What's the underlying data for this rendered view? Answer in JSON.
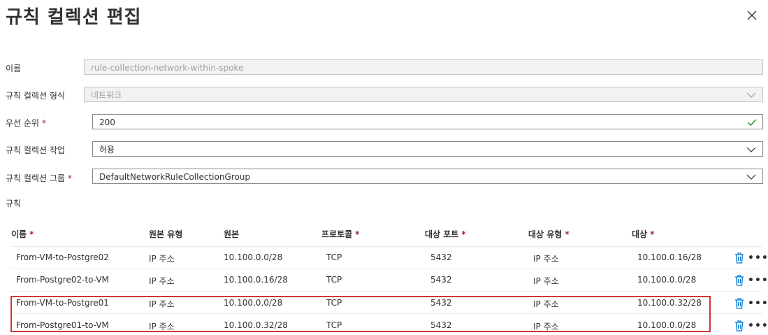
{
  "header": {
    "title": "규칙 컬렉션 편집"
  },
  "form": {
    "name": {
      "label": "이름",
      "value": "rule-collection-network-within-spoke"
    },
    "type": {
      "label": "규칙 컬렉션 형식",
      "value": "네트워크"
    },
    "priority": {
      "label": "우선 순위",
      "required": "*",
      "value": "200"
    },
    "action": {
      "label": "규칙 컬렉션 작업",
      "value": "허용"
    },
    "group": {
      "label": "규칙 컬렉션 그룹",
      "required": "*",
      "value": "DefaultNetworkRuleCollectionGroup"
    },
    "rules_label": "규칙"
  },
  "table": {
    "columns": [
      {
        "label": "이름",
        "required": "*"
      },
      {
        "label": "원본 유형",
        "required": ""
      },
      {
        "label": "원본",
        "required": ""
      },
      {
        "label": "프로토콜",
        "required": "*"
      },
      {
        "label": "대상 포트",
        "required": "*"
      },
      {
        "label": "대상 유형",
        "required": "*"
      },
      {
        "label": "대상",
        "required": "*"
      }
    ],
    "rows": [
      {
        "name": "From-VM-to-Postgre02",
        "source_type": "IP 주소",
        "source": "10.100.0.0/28",
        "protocol": "TCP",
        "port": "5432",
        "dest_type": "IP 주소",
        "dest": "10.100.0.16/28"
      },
      {
        "name": "From-Postgre02-to-VM",
        "source_type": "IP 주소",
        "source": "10.100.0.16/28",
        "protocol": "TCP",
        "port": "5432",
        "dest_type": "IP 주소",
        "dest": "10.100.0.0/28"
      },
      {
        "name": "From-VM-to-Postgre01",
        "source_type": "IP 주소",
        "source": "10.100.0.0/28",
        "protocol": "TCP",
        "port": "5432",
        "dest_type": "IP 주소",
        "dest": "10.100.0.32/28"
      },
      {
        "name": "From-Postgre01-to-VM",
        "source_type": "IP 주소",
        "source": "10.100.0.32/28",
        "protocol": "TCP",
        "port": "5432",
        "dest_type": "IP 주소",
        "dest": "10.100.0.0/28"
      }
    ],
    "more_glyph": "•••"
  },
  "colors": {
    "required": "#a4262c",
    "highlight": "#d13438",
    "trash": "#0078d4",
    "check": "#107c10"
  }
}
